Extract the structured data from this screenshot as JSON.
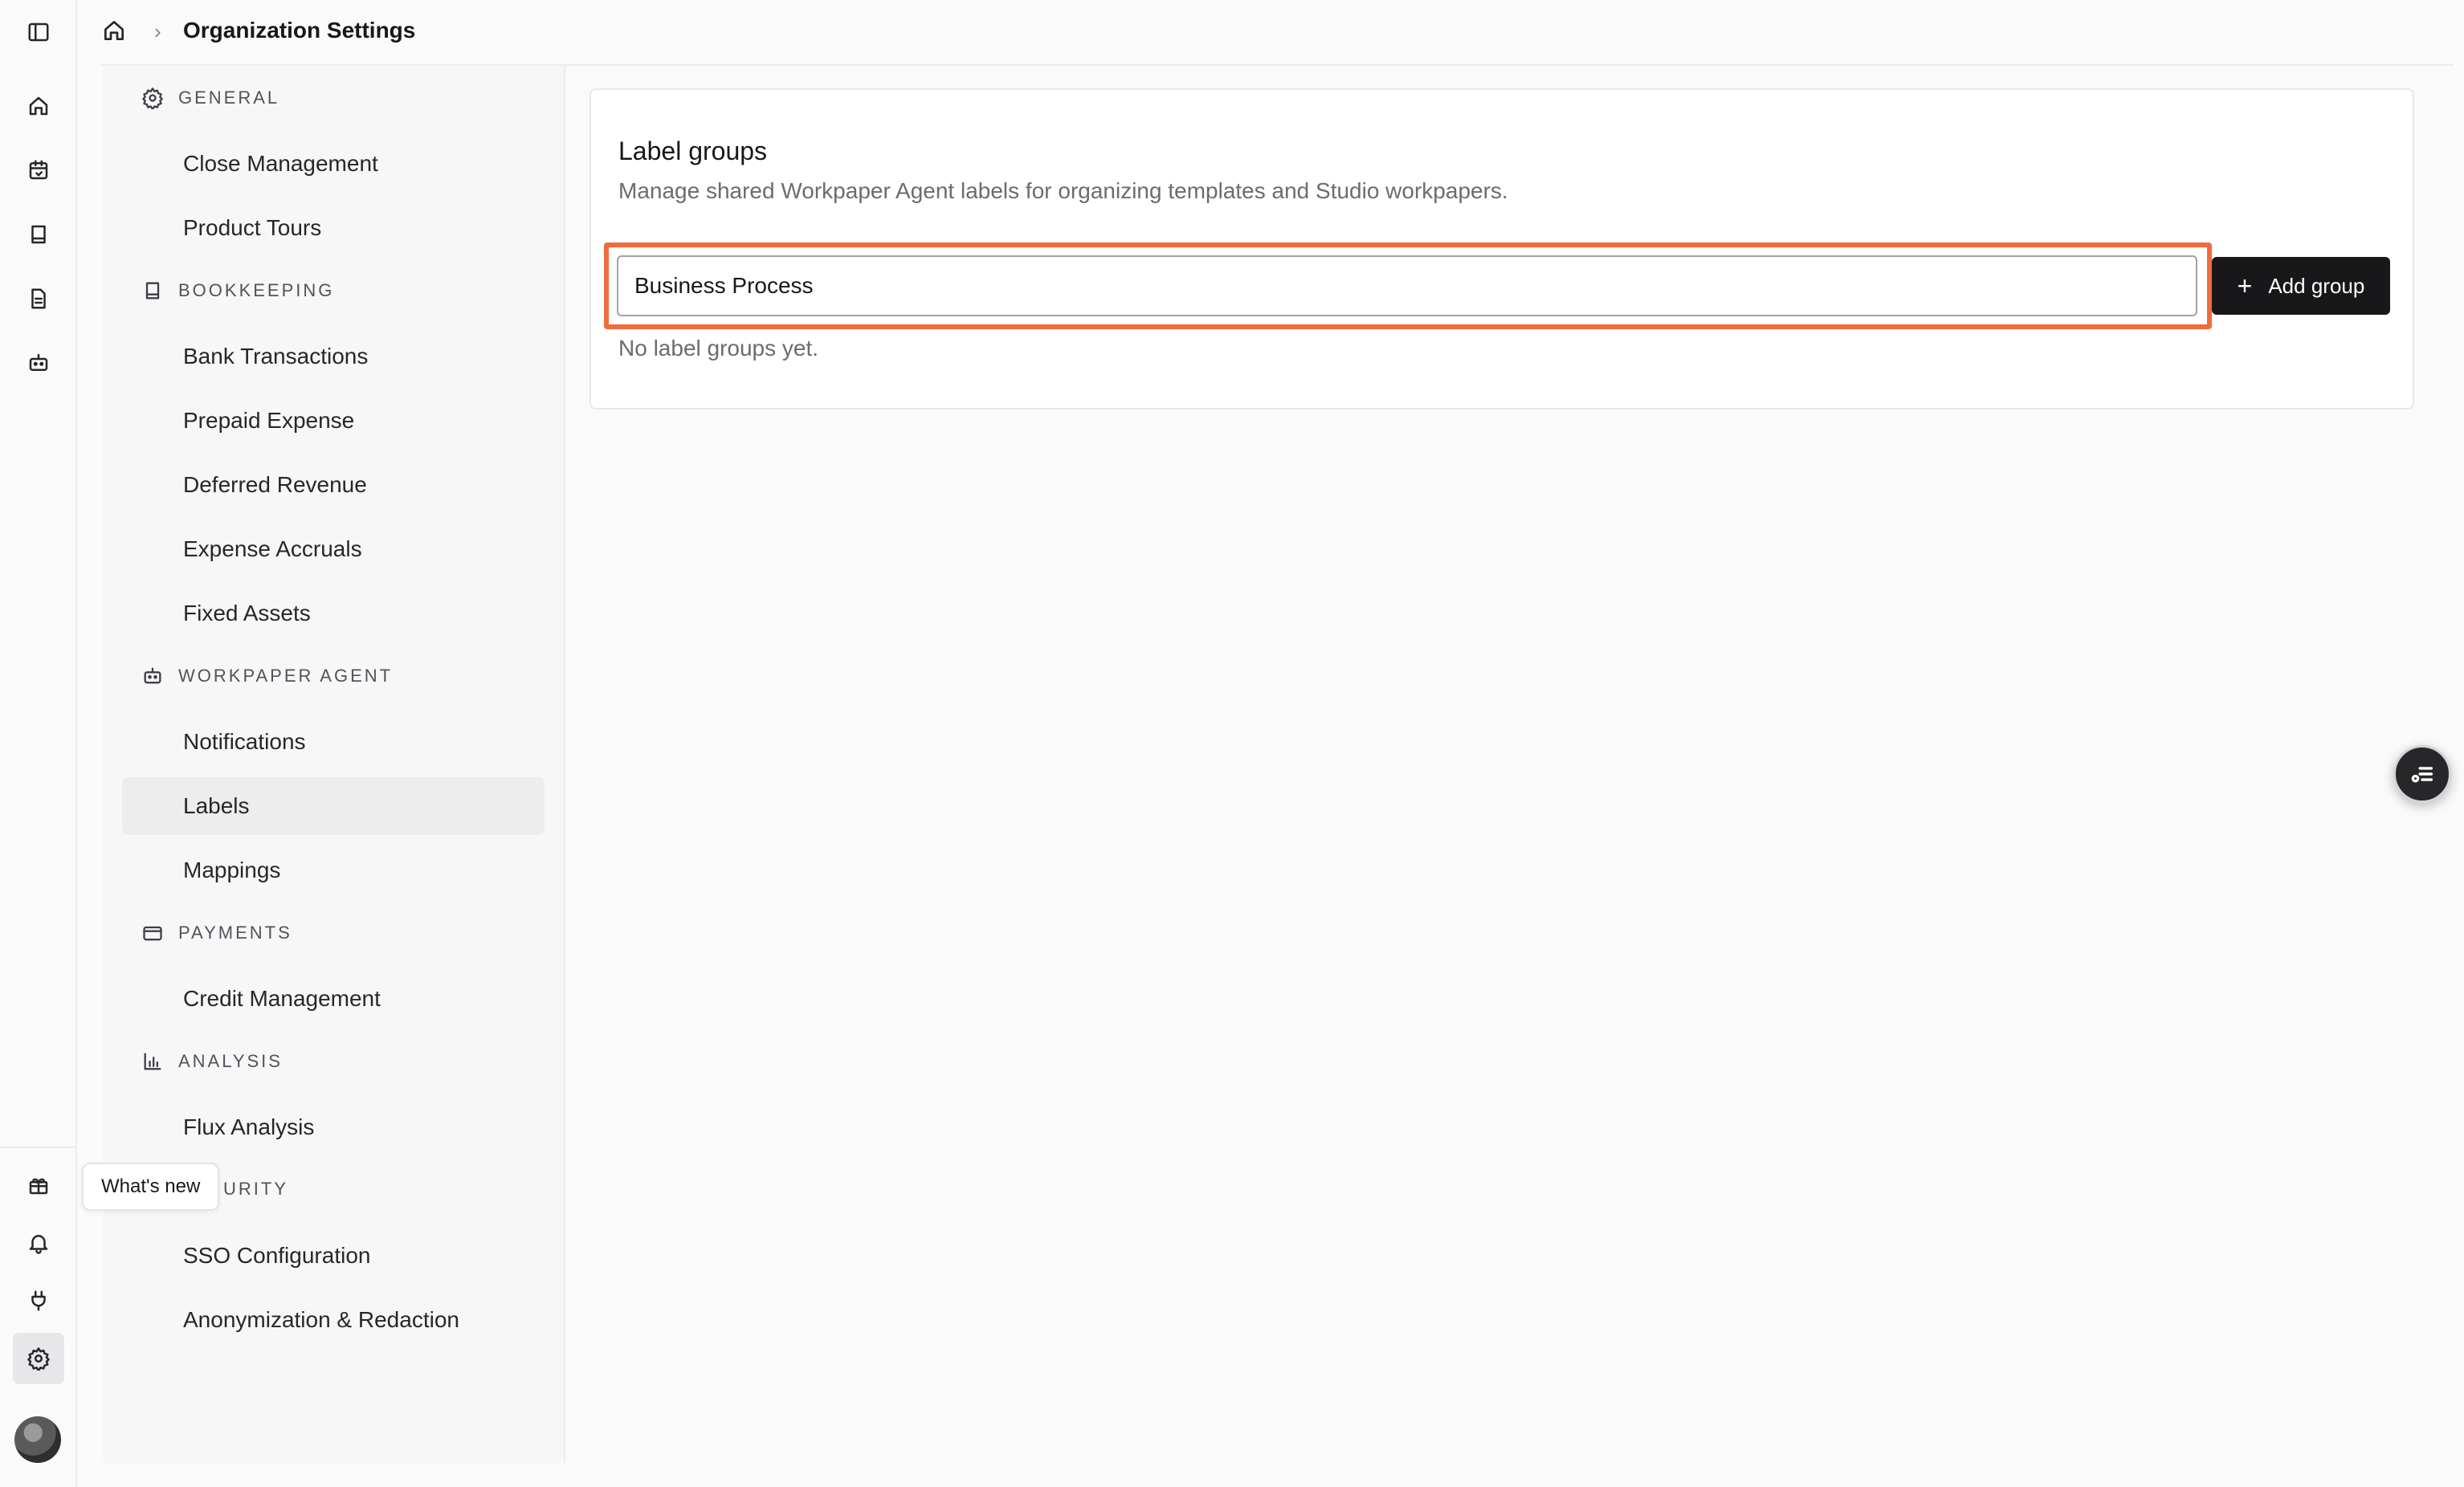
{
  "breadcrumb": {
    "title": "Organization Settings"
  },
  "tooltip": {
    "text": "What's new"
  },
  "nav": {
    "sections": [
      {
        "label": "GENERAL",
        "icon": "gear-icon",
        "items": [
          "Close Management",
          "Product Tours"
        ]
      },
      {
        "label": "BOOKKEEPING",
        "icon": "book-icon",
        "items": [
          "Bank Transactions",
          "Prepaid Expense",
          "Deferred Revenue",
          "Expense Accruals",
          "Fixed Assets"
        ]
      },
      {
        "label": "WORKPAPER AGENT",
        "icon": "bot-icon",
        "items": [
          "Notifications",
          "Labels",
          "Mappings"
        ]
      },
      {
        "label": "PAYMENTS",
        "icon": "credit-card-icon",
        "items": [
          "Credit Management"
        ]
      },
      {
        "label": "ANALYSIS",
        "icon": "bar-chart-icon",
        "items": [
          "Flux Analysis"
        ]
      },
      {
        "label": "URITY",
        "icon": "shield-icon",
        "items": [
          "SSO Configuration",
          "Anonymization & Redaction"
        ]
      }
    ],
    "active_item": "Labels"
  },
  "card": {
    "title": "Label groups",
    "description": "Manage shared Workpaper Agent labels for organizing templates and Studio workpapers.",
    "input_value": "Business Process",
    "add_button_label": "Add group",
    "empty_message": "No label groups yet."
  },
  "colors": {
    "highlight": "#f26b3a",
    "button_bg": "#18181b"
  }
}
